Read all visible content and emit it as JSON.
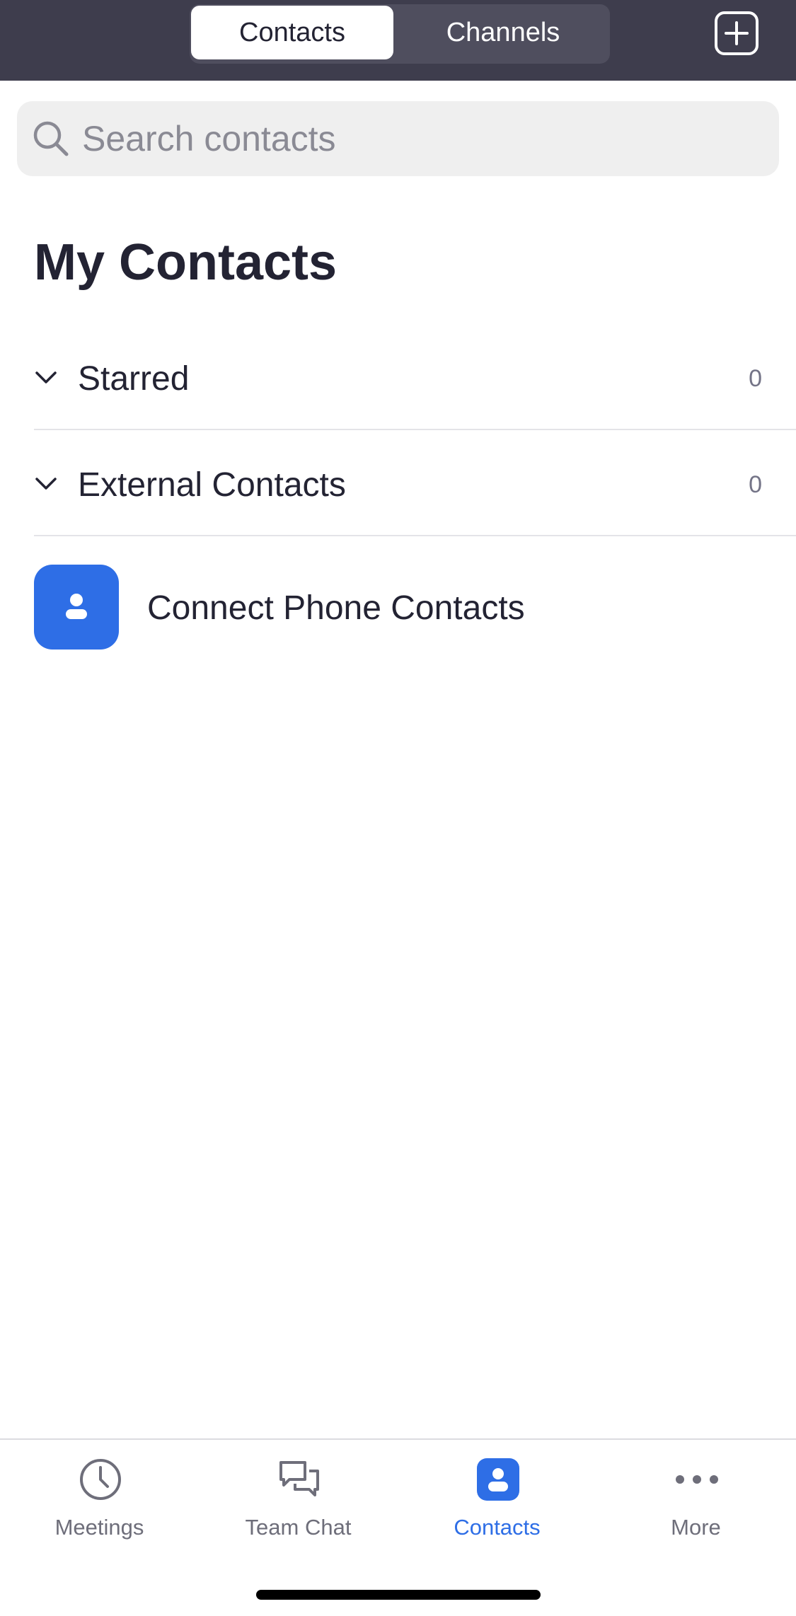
{
  "header": {
    "segments": [
      {
        "label": "Contacts",
        "active": true
      },
      {
        "label": "Channels",
        "active": false
      }
    ],
    "add_icon": "plus-square-icon"
  },
  "search": {
    "placeholder": "Search contacts",
    "value": ""
  },
  "page_title": "My Contacts",
  "sections": [
    {
      "label": "Starred",
      "count": "0",
      "expanded_icon": "chevron-down-icon"
    },
    {
      "label": "External Contacts",
      "count": "0",
      "expanded_icon": "chevron-down-icon"
    }
  ],
  "connect_phone": {
    "label": "Connect Phone Contacts",
    "icon": "person-icon"
  },
  "tabbar": {
    "items": [
      {
        "label": "Meetings",
        "icon": "clock-icon",
        "active": false
      },
      {
        "label": "Team Chat",
        "icon": "chat-bubbles-icon",
        "active": false
      },
      {
        "label": "Contacts",
        "icon": "contacts-icon",
        "active": true
      },
      {
        "label": "More",
        "icon": "more-dots-icon",
        "active": false
      }
    ]
  },
  "colors": {
    "header_bg": "#3e3d4d",
    "accent": "#2e6ee6",
    "text": "#232333",
    "muted": "#6e6e7a"
  }
}
